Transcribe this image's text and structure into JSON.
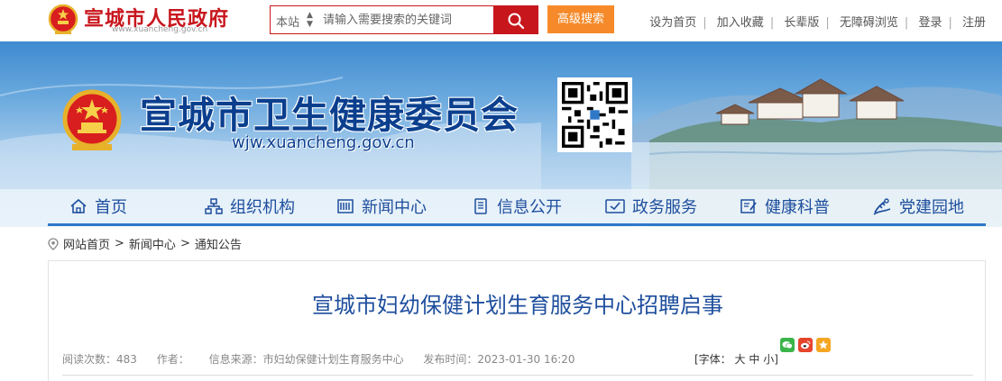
{
  "header": {
    "site_name": "宣城市人民政府",
    "site_url": "www.xuancheng.gov.cn",
    "search": {
      "scope": "本站",
      "placeholder": "请输入需要搜索的关键词",
      "button_icon": "search-icon",
      "advanced_label": "高级搜索"
    },
    "links": [
      "设为首页",
      "加入收藏",
      "长辈版",
      "无障碍浏览",
      "登录",
      "注册"
    ]
  },
  "banner": {
    "title": "宣城市卫生健康委员会",
    "url": "wjw.xuancheng.gov.cn"
  },
  "nav": {
    "items": [
      {
        "label": "首页",
        "icon": "home-icon"
      },
      {
        "label": "组织机构",
        "icon": "org-chart-icon"
      },
      {
        "label": "新闻中心",
        "icon": "newspaper-icon"
      },
      {
        "label": "信息公开",
        "icon": "document-icon"
      },
      {
        "label": "政务服务",
        "icon": "checkbox-icon"
      },
      {
        "label": "健康科普",
        "icon": "edit-note-icon"
      },
      {
        "label": "党建园地",
        "icon": "party-flag-icon"
      }
    ]
  },
  "breadcrumb": {
    "icon": "location-pin-icon",
    "items": [
      "网站首页",
      "新闻中心",
      "通知公告"
    ],
    "separator": ">"
  },
  "article": {
    "title": "宣城市妇幼保健计划生育服务中心招聘启事",
    "meta": {
      "views": "阅读次数：483",
      "author": "作者：",
      "source": "信息来源：市妇幼保健计划生育服务中心",
      "published": "发布时间：2023-01-30 16:20"
    },
    "font_size": {
      "prefix": "[字体：",
      "large": "大",
      "medium": "中",
      "small": "小",
      "suffix": "]"
    },
    "share_icons": [
      "wechat-icon",
      "weibo-icon",
      "qzone-icon"
    ]
  },
  "colors": {
    "brand_red": "#c8161d",
    "advanced_orange": "#f68a2a",
    "nav_blue": "#1e4e9d",
    "title_blue": "#0b3f8e"
  }
}
